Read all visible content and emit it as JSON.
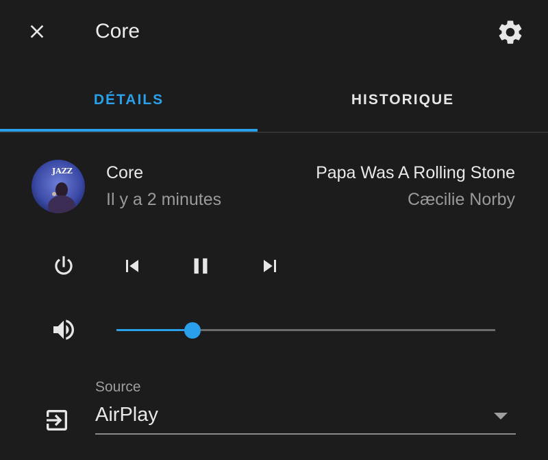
{
  "header": {
    "title": "Core",
    "close_icon": "close-icon",
    "settings_icon": "gear-icon"
  },
  "tabs": [
    {
      "label": "DÉTAILS",
      "active": true
    },
    {
      "label": "HISTORIQUE",
      "active": false
    }
  ],
  "now_playing": {
    "player_name": "Core",
    "last_changed": "Il y a 2 minutes",
    "track_title": "Papa Was A Rolling Stone",
    "artist": "Cæcilie Norby",
    "artwork_text": "JAZZ"
  },
  "controls": {
    "power_icon": "power-icon",
    "previous_icon": "skip-previous-icon",
    "pause_icon": "pause-icon",
    "next_icon": "skip-next-icon"
  },
  "volume": {
    "icon": "volume-high-icon",
    "level": 0.2
  },
  "source": {
    "label": "Source",
    "value": "AirPlay",
    "icon": "login-variant-icon"
  },
  "colors": {
    "accent": "#2aa0eb",
    "background": "#1c1c1c",
    "primary_text": "#e8e8e8",
    "secondary_text": "#9a9a9a"
  }
}
